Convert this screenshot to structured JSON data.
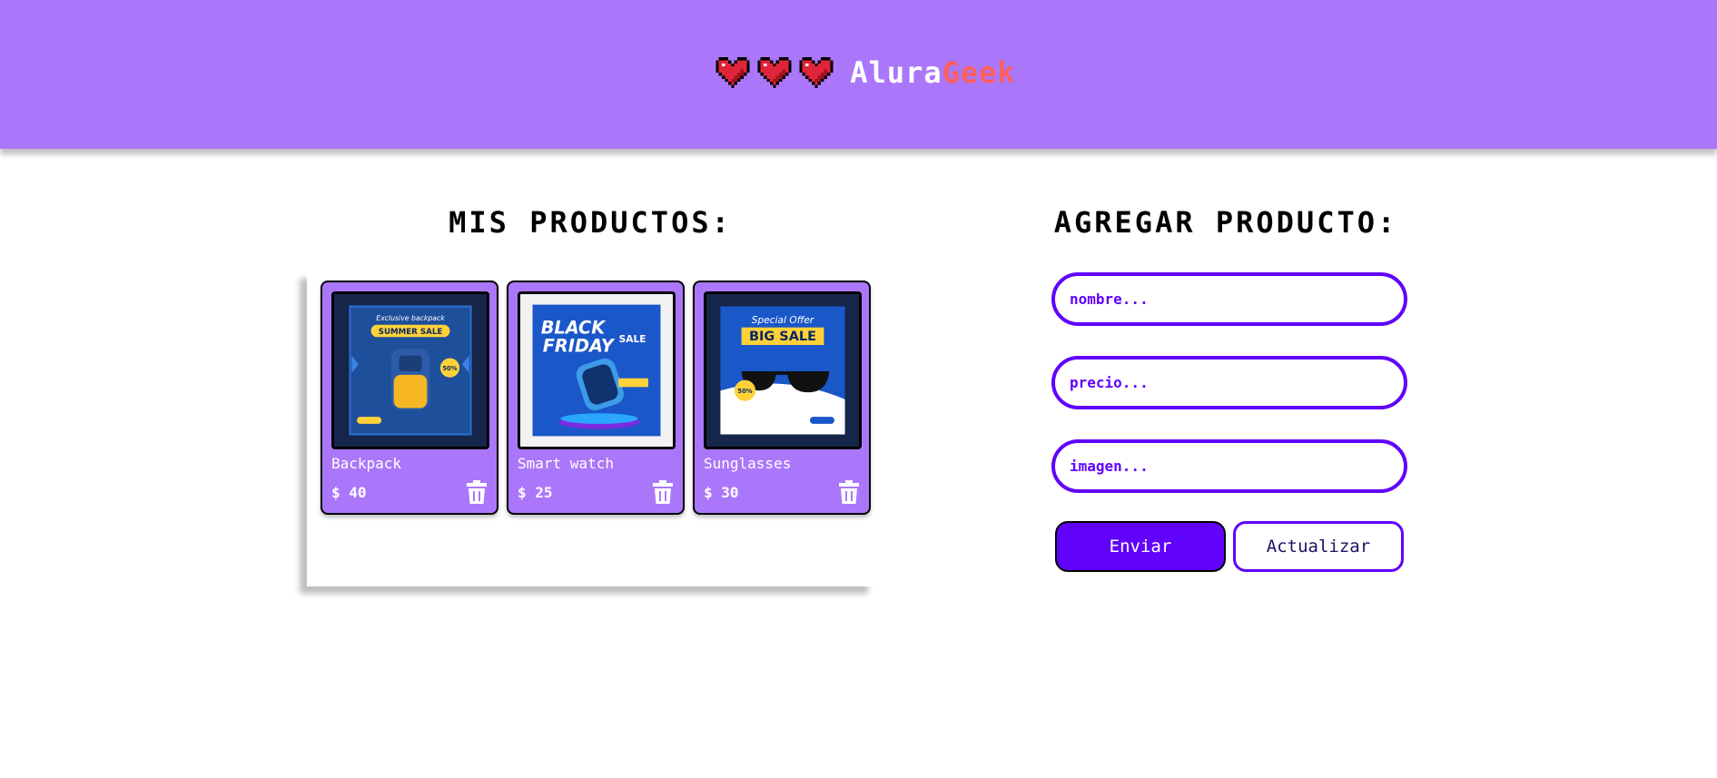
{
  "header": {
    "logo_part1": "Alura",
    "logo_part2": "Geek",
    "heart_icons": [
      "pixel-heart-icon",
      "pixel-heart-icon",
      "pixel-heart-icon"
    ]
  },
  "products_section": {
    "title": "MIS PRODUCTOS:",
    "products": [
      {
        "name": "Backpack",
        "price": "$ 40",
        "image_text_1": "Exclusive backpack",
        "image_text_2": "SUMMER SALE",
        "image_badge": "50%"
      },
      {
        "name": "Smart watch",
        "price": "$ 25",
        "image_text_1": "BLACK",
        "image_text_2": "FRIDAY",
        "image_text_3": "SALE"
      },
      {
        "name": "Sunglasses",
        "price": "$ 30",
        "image_text_1": "Special Offer",
        "image_text_2": "BIG SALE",
        "image_badge": "50%"
      }
    ]
  },
  "form_section": {
    "title": "AGREGAR PRODUCTO:",
    "name_placeholder": "nombre...",
    "price_placeholder": "precio...",
    "image_placeholder": "imagen...",
    "send_label": "Enviar",
    "update_label": "Actualizar"
  },
  "colors": {
    "header_bg": "#ab77fa",
    "card_bg": "#ab77fa",
    "accent": "#6103fb",
    "logo_highlight": "#ff5f5f"
  }
}
